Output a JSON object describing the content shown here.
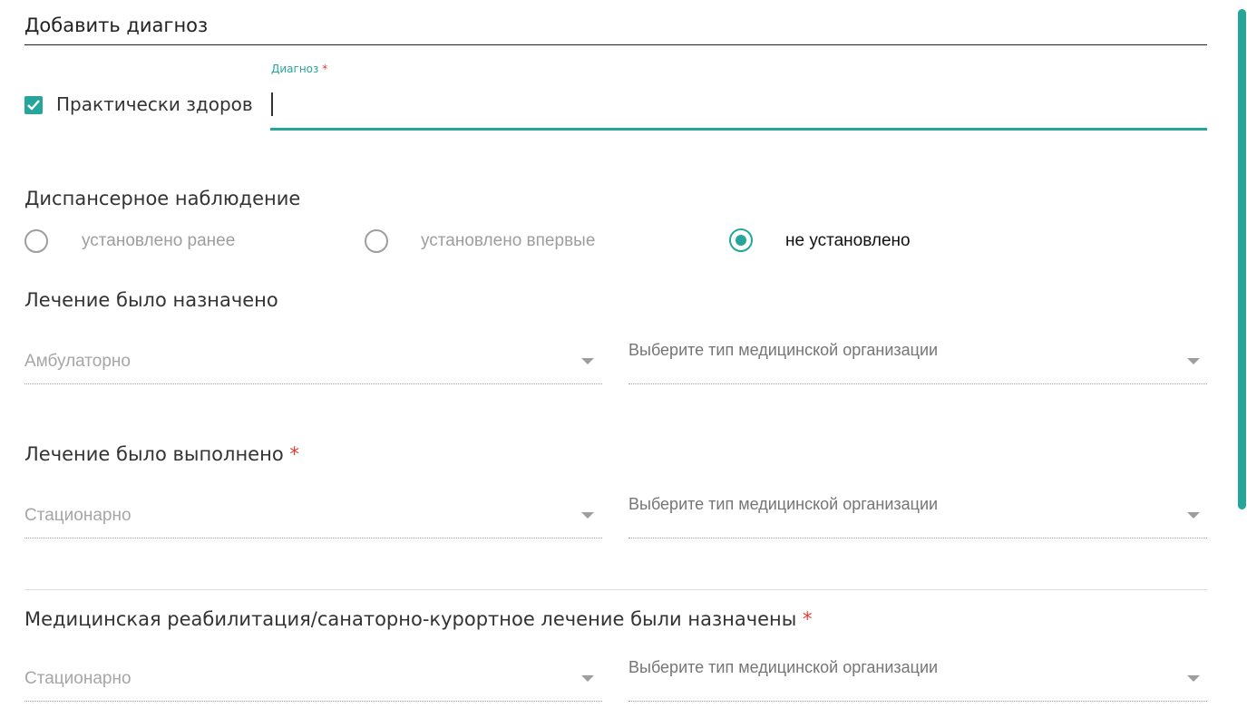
{
  "header": {
    "title": "Добавить диагноз"
  },
  "healthy_checkbox": {
    "label": "Практически здоров",
    "checked": true
  },
  "diagnosis": {
    "label": "Диагноз",
    "required_mark": "*",
    "value": "",
    "placeholder": ""
  },
  "dispensary": {
    "title": "Диспансерное наблюдение",
    "options": [
      {
        "label": "установлено ранее",
        "checked": false
      },
      {
        "label": "установлено впервые",
        "checked": false
      },
      {
        "label": "не установлено",
        "checked": true
      }
    ]
  },
  "treatment_assigned": {
    "title": "Лечение было назначено",
    "required_mark": "",
    "type_value": "Амбулаторно",
    "org_placeholder": "Выберите тип медицинской организации"
  },
  "treatment_done": {
    "title": "Лечение было выполнено",
    "required_mark": "*",
    "type_value": "Стационарно",
    "org_placeholder": "Выберите тип медицинской организации"
  },
  "rehab": {
    "title": "Медицинская реабилитация/санаторно-курортное лечение были назначены",
    "required_mark": "*",
    "type_value": "Стационарно",
    "org_placeholder": "Выберите тип медицинской организации"
  },
  "colors": {
    "accent": "#26a69a",
    "required": "#e53935"
  }
}
